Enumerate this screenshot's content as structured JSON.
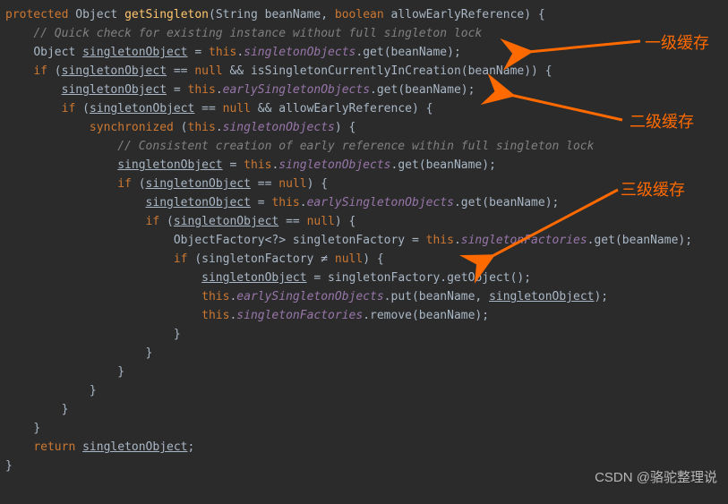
{
  "code": {
    "l1": {
      "kw_protected": "protected",
      "type_object": "Object",
      "method": "getSingleton",
      "p_open": "(",
      "type_string": "String",
      "arg_bean": "beanName",
      "comma": ", ",
      "kw_boolean": "boolean",
      "arg_allow": "allowEarlyReference",
      "p_close": ") {"
    },
    "l2": {
      "cmt": "// Quick check for existing instance without full singleton lock"
    },
    "l3": {
      "type_object": "Object ",
      "var": "singletonObject",
      "eq": " = ",
      "this": "this",
      "dot1": ".",
      "fld": "singletonObjects",
      "dot2": ".",
      "call": "get",
      "p": "(beanName);"
    },
    "l4": {
      "kw_if": "if",
      "p1": " (",
      "var": "singletonObject",
      "eq": " == ",
      "null": "null",
      "and": " && ",
      "call": "isSingletonCurrentlyInCreation",
      "p2": "(beanName)) {"
    },
    "l5": {
      "var": "singletonObject",
      "eq": " = ",
      "this": "this",
      "dot1": ".",
      "fld": "earlySingletonObjects",
      "dot2": ".",
      "call": "get",
      "p": "(beanName);"
    },
    "l6": {
      "kw_if": "if",
      "p1": " (",
      "var": "singletonObject",
      "eq": " == ",
      "null": "null",
      "and": " && ",
      "arg": "allowEarlyReference",
      "p2": ") {"
    },
    "l7": {
      "kw_sync": "synchronized",
      "p1": " (",
      "this": "this",
      "dot": ".",
      "fld": "singletonObjects",
      "p2": ") {"
    },
    "l8": {
      "cmt": "// Consistent creation of early reference within full singleton lock"
    },
    "l9": {
      "var": "singletonObject",
      "eq": " = ",
      "this": "this",
      "dot1": ".",
      "fld": "singletonObjects",
      "dot2": ".",
      "call": "get",
      "p": "(beanName);"
    },
    "l10": {
      "kw_if": "if",
      "p1": " (",
      "var": "singletonObject",
      "eq": " == ",
      "null": "null",
      "p2": ") {"
    },
    "l11": {
      "var": "singletonObject",
      "eq": " = ",
      "this": "this",
      "dot1": ".",
      "fld": "earlySingletonObjects",
      "dot2": ".",
      "call": "get",
      "p": "(beanName);"
    },
    "l12": {
      "kw_if": "if",
      "p1": " (",
      "var": "singletonObject",
      "eq": " == ",
      "null": "null",
      "p2": ") {"
    },
    "l13": {
      "type": "ObjectFactory<?> ",
      "var": "singletonFactory",
      "eq": " = ",
      "this": "this",
      "dot1": ".",
      "fld": "singletonFactories",
      "dot2": ".",
      "call": "get",
      "p": "(beanName);"
    },
    "l14": {
      "kw_if": "if",
      "p1": " (",
      "var": "singletonFactory",
      "neq": " ≠ ",
      "null": "null",
      "p2": ") {"
    },
    "l15": {
      "var": "singletonObject",
      "eq": " = ",
      "call1": "singletonFactory",
      "dot": ".",
      "call2": "getObject",
      "p": "();"
    },
    "l16": {
      "this": "this",
      "dot1": ".",
      "fld": "earlySingletonObjects",
      "dot2": ".",
      "call": "put",
      "p1": "(beanName, ",
      "var": "singletonObject",
      "p2": ");"
    },
    "l17": {
      "this": "this",
      "dot1": ".",
      "fld": "singletonFactories",
      "dot2": ".",
      "call": "remove",
      "p": "(beanName);"
    },
    "l18": "}",
    "l19": "}",
    "l20": "}",
    "l21": "}",
    "l22": "}",
    "l23": "}",
    "l24": {
      "kw_return": "return",
      "sp": " ",
      "var": "singletonObject",
      "end": ";"
    },
    "l25": "}"
  },
  "annotations": {
    "level1": "一级缓存",
    "level2": "二级缓存",
    "level3": "三级缓存"
  },
  "watermark": "CSDN @骆驼整理说"
}
